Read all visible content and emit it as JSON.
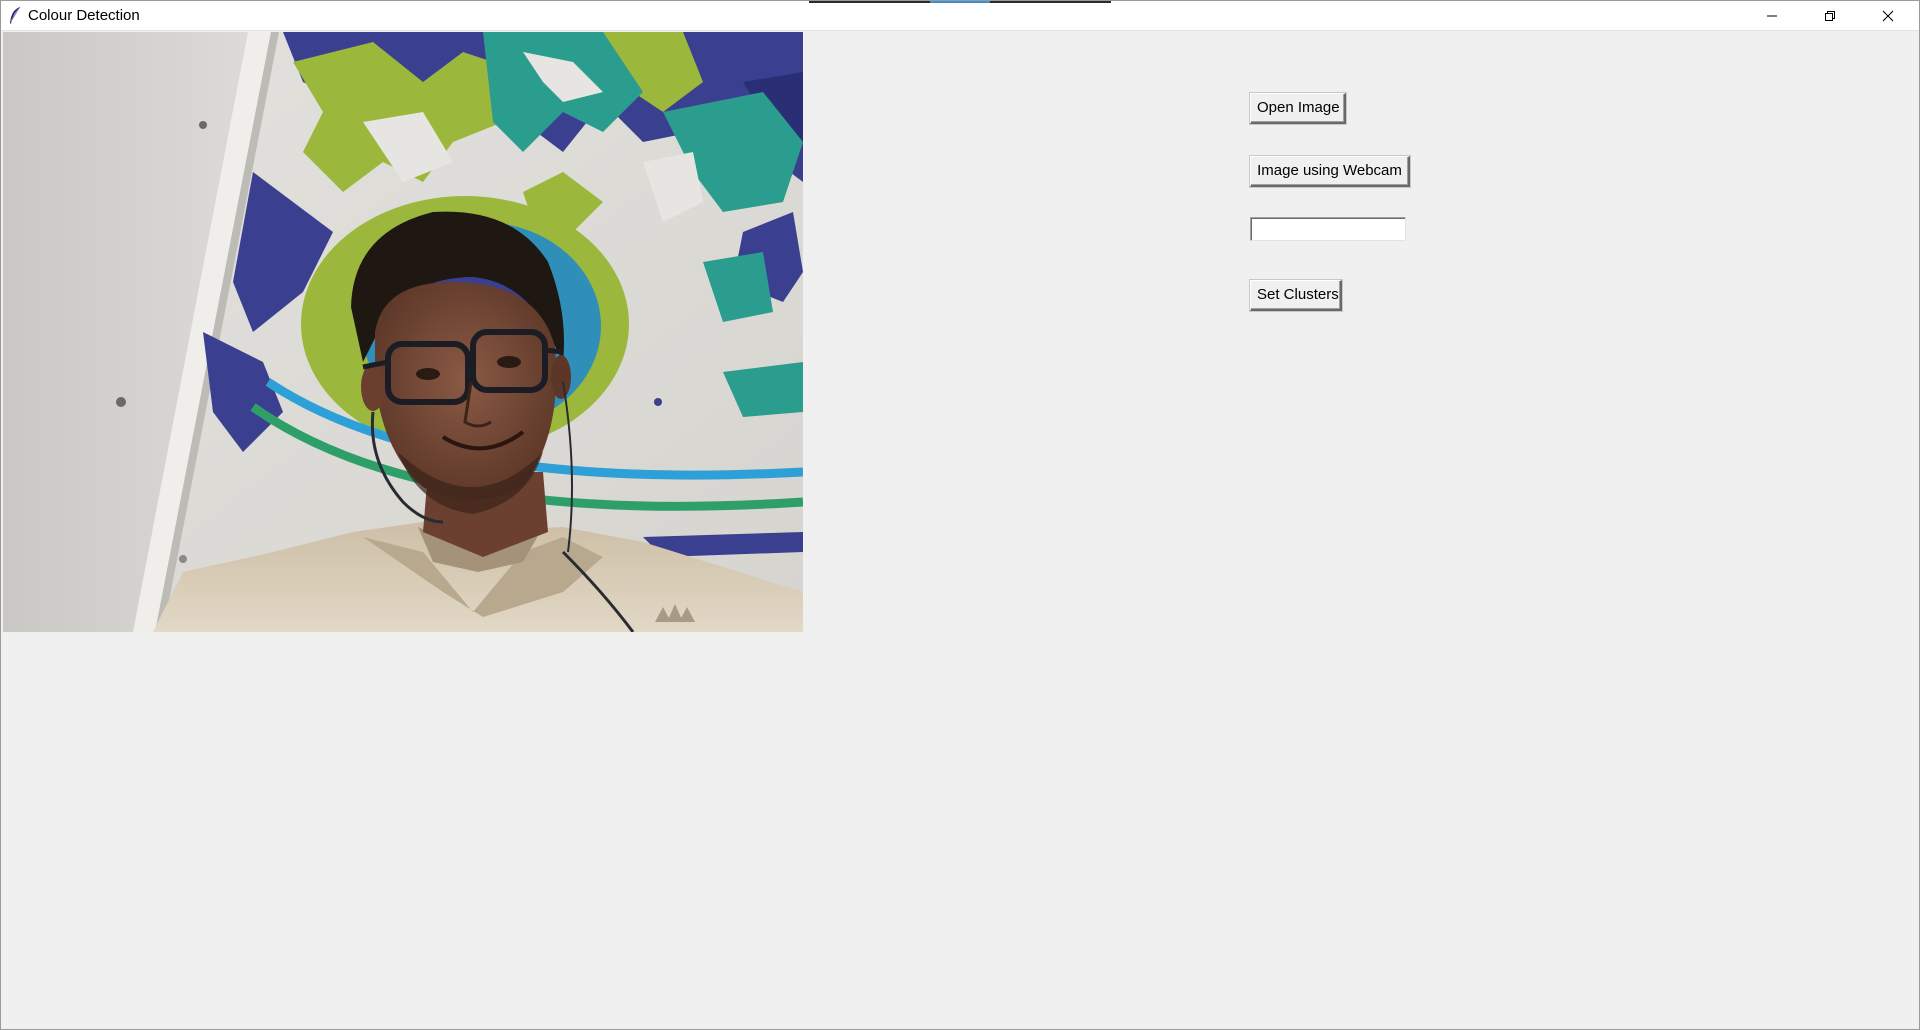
{
  "window": {
    "title": "Colour Detection"
  },
  "title_controls": {
    "minimize_icon": "minimize-icon",
    "restore_icon": "restore-icon",
    "close_icon": "close-icon"
  },
  "controls": {
    "open_image_label": "Open Image",
    "webcam_label": "Image using Webcam",
    "clusters_input_value": "",
    "set_clusters_label": "Set Clusters"
  },
  "image": {
    "source": "webcam",
    "subject": "smiling person with glasses and earphones, beige polo shirt, wall mural in green, teal and navy behind"
  },
  "colors": {
    "window_bg": "#f0f0f0",
    "titlebar_bg": "#ffffff",
    "mural_green": "#9cb83c",
    "mural_teal": "#2a9d8f",
    "mural_navy": "#3a3f8f",
    "mural_blue": "#2f9fd8",
    "shirt_beige": "#d8cbb5"
  }
}
